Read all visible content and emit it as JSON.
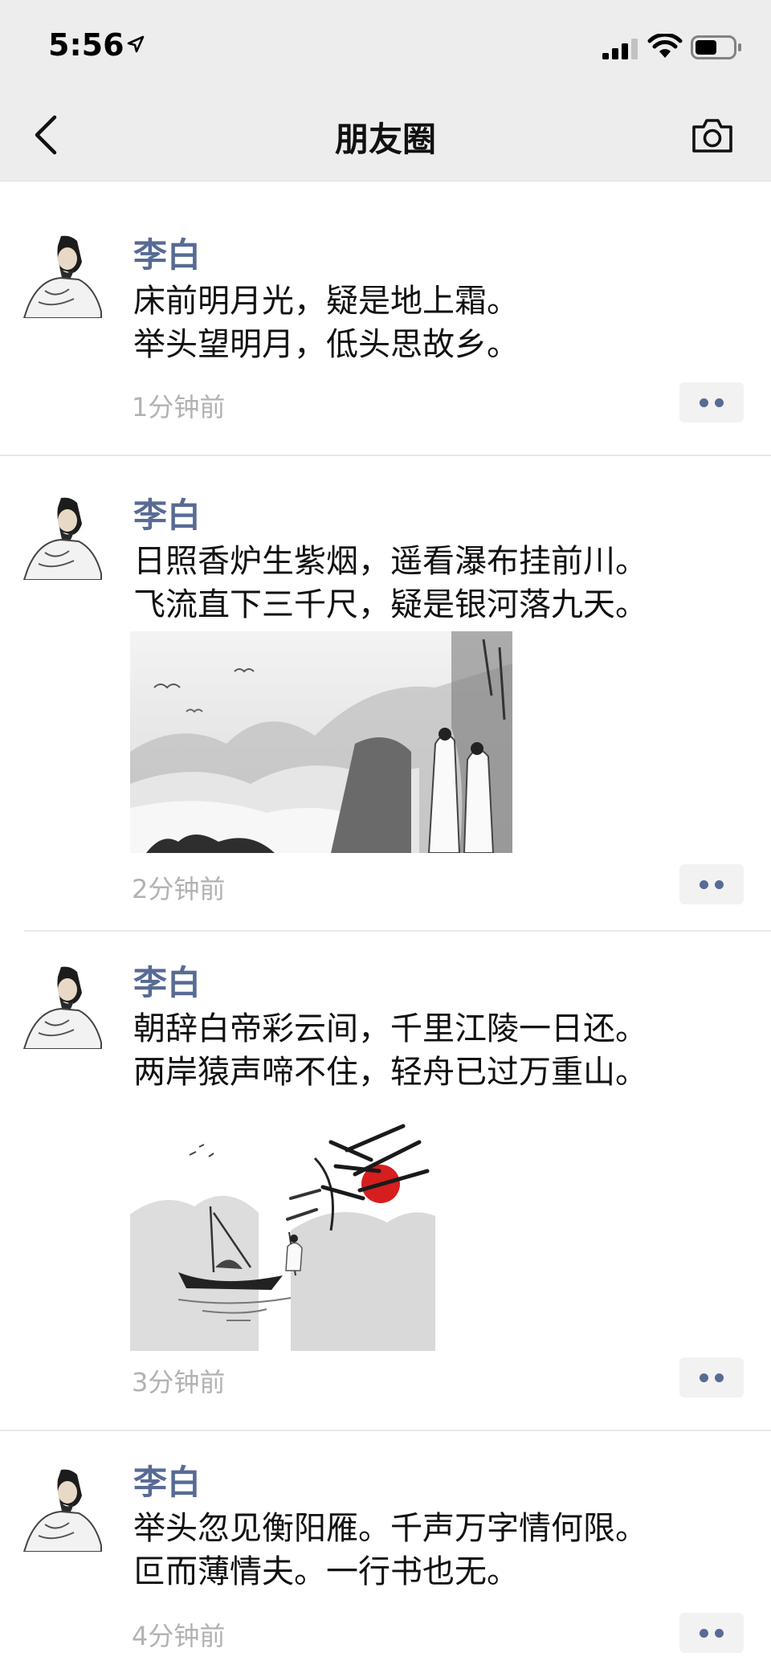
{
  "status_bar": {
    "time": "5:56"
  },
  "nav": {
    "title": "朋友圈"
  },
  "posts": [
    {
      "author": "李白",
      "text": "床前明月光，疑是地上霜。\n举头望明月，低头思故乡。",
      "time": "1分钟前"
    },
    {
      "author": "李白",
      "text": "日照香炉生紫烟，遥看瀑布挂前川。\n飞流直下三千尺，疑是银河落九天。",
      "time": "2分钟前"
    },
    {
      "author": "李白",
      "text": "朝辞白帝彩云间，千里江陵一日还。\n两岸猿声啼不住，轻舟已过万重山。",
      "time": "3分钟前"
    },
    {
      "author": "李白",
      "text": "举头忽见衡阳雁。千声万字情何限。\n叵而薄情夫。一行书也无。",
      "time": "4分钟前"
    }
  ],
  "colors": {
    "author": "#576b95",
    "time": "#b2b2b2",
    "bar": "#ededed"
  }
}
